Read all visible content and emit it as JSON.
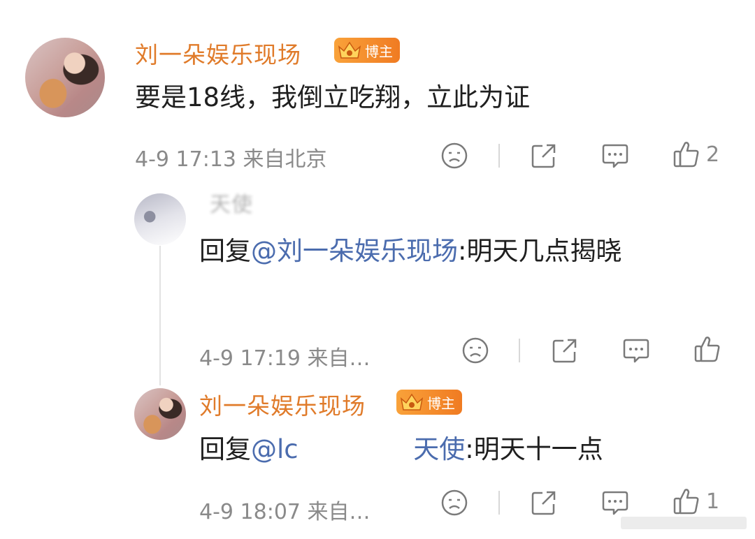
{
  "comment": {
    "username": "刘一朵娱乐现场",
    "badge_label": "博主",
    "text": "要是18线，我倒立吃翔，立此为证",
    "time": "4-9 17:13",
    "location": "来自北京",
    "like_count": "2"
  },
  "reply1": {
    "username": "天使",
    "prefix": "回复",
    "mention": "@刘一朵娱乐现场",
    "text": ":明天几点揭晓",
    "time": "4-9 17:19",
    "location": "来自…"
  },
  "reply2": {
    "username": "刘一朵娱乐现场",
    "badge_label": "博主",
    "prefix": "回复",
    "mention_start": "@lc",
    "mention_end": "天使",
    "text": ":明天十一点",
    "time": "4-9 18:07",
    "location": "来自…",
    "like_count": "1"
  },
  "icons": {
    "dislike": "sad-face-icon",
    "share": "share-icon",
    "comment": "comment-icon",
    "like": "thumbs-up-icon"
  },
  "colors": {
    "username": "#e07b2a",
    "mention": "#4b6cae",
    "meta": "#8a8a8a",
    "badge": "#f07b22"
  }
}
